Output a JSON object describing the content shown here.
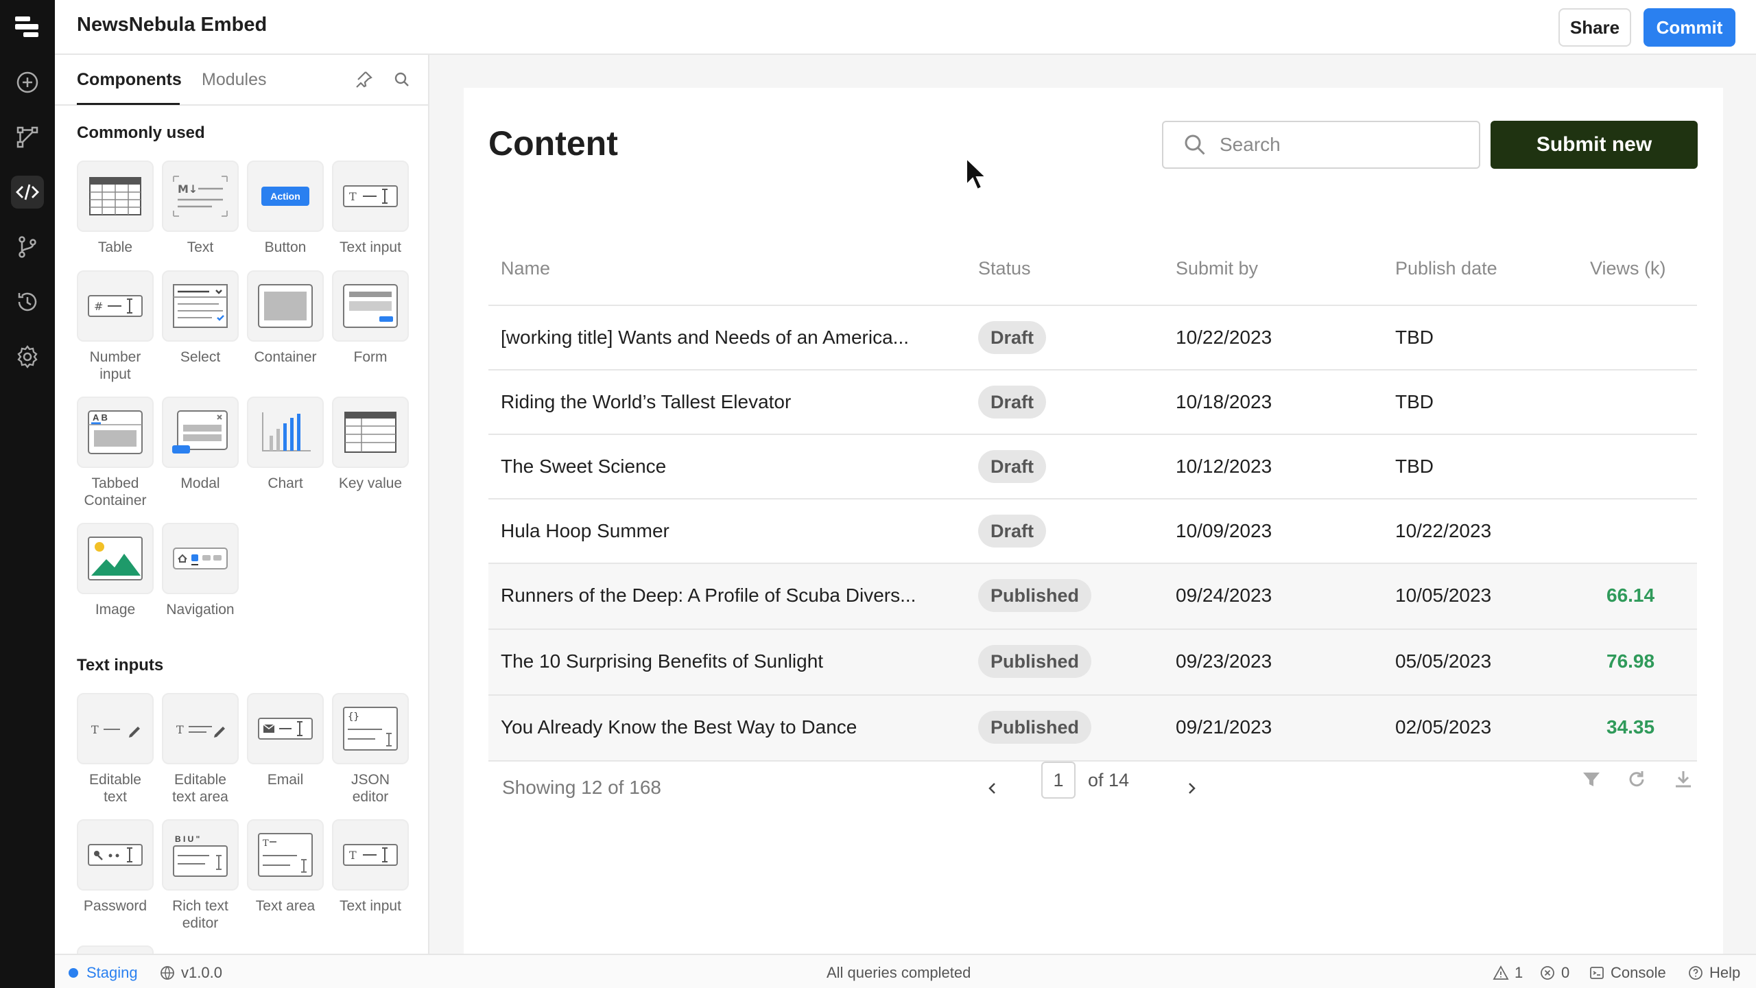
{
  "app": {
    "title": "NewsNebula Embed"
  },
  "header": {
    "share_label": "Share",
    "commit_label": "Commit"
  },
  "rail": {
    "items": [
      {
        "icon": "plus-circle-icon"
      },
      {
        "icon": "flow-icon"
      },
      {
        "icon": "code-icon",
        "active": true
      },
      {
        "icon": "branch-icon"
      },
      {
        "icon": "history-icon"
      },
      {
        "icon": "gear-icon"
      }
    ]
  },
  "panel": {
    "tabs": [
      {
        "label": "Components",
        "active": true
      },
      {
        "label": "Modules",
        "active": false
      }
    ],
    "sections": {
      "common": "Commonly used",
      "text_inputs": "Text inputs"
    },
    "common_items": [
      {
        "label": "Table"
      },
      {
        "label": "Text"
      },
      {
        "label": "Button",
        "icon_text": "Action"
      },
      {
        "label": "Text input"
      },
      {
        "label": "Number input"
      },
      {
        "label": "Select"
      },
      {
        "label": "Container"
      },
      {
        "label": "Form"
      },
      {
        "label": "Tabbed Container",
        "icon_text": "A B"
      },
      {
        "label": "Modal"
      },
      {
        "label": "Chart"
      },
      {
        "label": "Key value"
      },
      {
        "label": "Image"
      },
      {
        "label": "Navigation"
      }
    ],
    "text_items": [
      {
        "label": "Editable text"
      },
      {
        "label": "Editable text area"
      },
      {
        "label": "Email"
      },
      {
        "label": "JSON editor"
      },
      {
        "label": "Password"
      },
      {
        "label": "Rich text editor",
        "icon_text": "B I U \""
      },
      {
        "label": "Text area"
      },
      {
        "label": "Text input"
      }
    ]
  },
  "main": {
    "title": "Content",
    "search_placeholder": "Search",
    "submit_label": "Submit new",
    "columns": [
      "Name",
      "Status",
      "Submit by",
      "Publish date",
      "Views (k)"
    ],
    "rows": [
      {
        "name": "[working title] Wants and Needs of an America...",
        "status": "Draft",
        "submit_by": "10/22/2023",
        "publish_date": "TBD",
        "views": ""
      },
      {
        "name": "Riding the World’s Tallest Elevator",
        "status": "Draft",
        "submit_by": "10/18/2023",
        "publish_date": "TBD",
        "views": ""
      },
      {
        "name": "The Sweet Science",
        "status": "Draft",
        "submit_by": "10/12/2023",
        "publish_date": "TBD",
        "views": ""
      },
      {
        "name": "Hula Hoop Summer",
        "status": "Draft",
        "submit_by": "10/09/2023",
        "publish_date": "10/22/2023",
        "views": ""
      },
      {
        "name": "Runners of the Deep: A Profile of Scuba Divers...",
        "status": "Published",
        "submit_by": "09/24/2023",
        "publish_date": "10/05/2023",
        "views": "66.14"
      },
      {
        "name": "The 10 Surprising Benefits of Sunlight",
        "status": "Published",
        "submit_by": "09/23/2023",
        "publish_date": "05/05/2023",
        "views": "76.98"
      },
      {
        "name": "You Already Know the Best Way to Dance",
        "status": "Published",
        "submit_by": "09/21/2023",
        "publish_date": "02/05/2023",
        "views": "34.35"
      }
    ],
    "footer": {
      "showing": "Showing 12 of 168",
      "page": "1",
      "of_pages": "of 14"
    }
  },
  "status_bar": {
    "env": "Staging",
    "version": "v1.0.0",
    "queries": "All queries completed",
    "warnings": "1",
    "errors": "0",
    "console": "Console",
    "help": "Help"
  },
  "colors": {
    "accent": "#2a80f0",
    "submit": "#1f3311",
    "views_green": "#2f9a5a"
  }
}
